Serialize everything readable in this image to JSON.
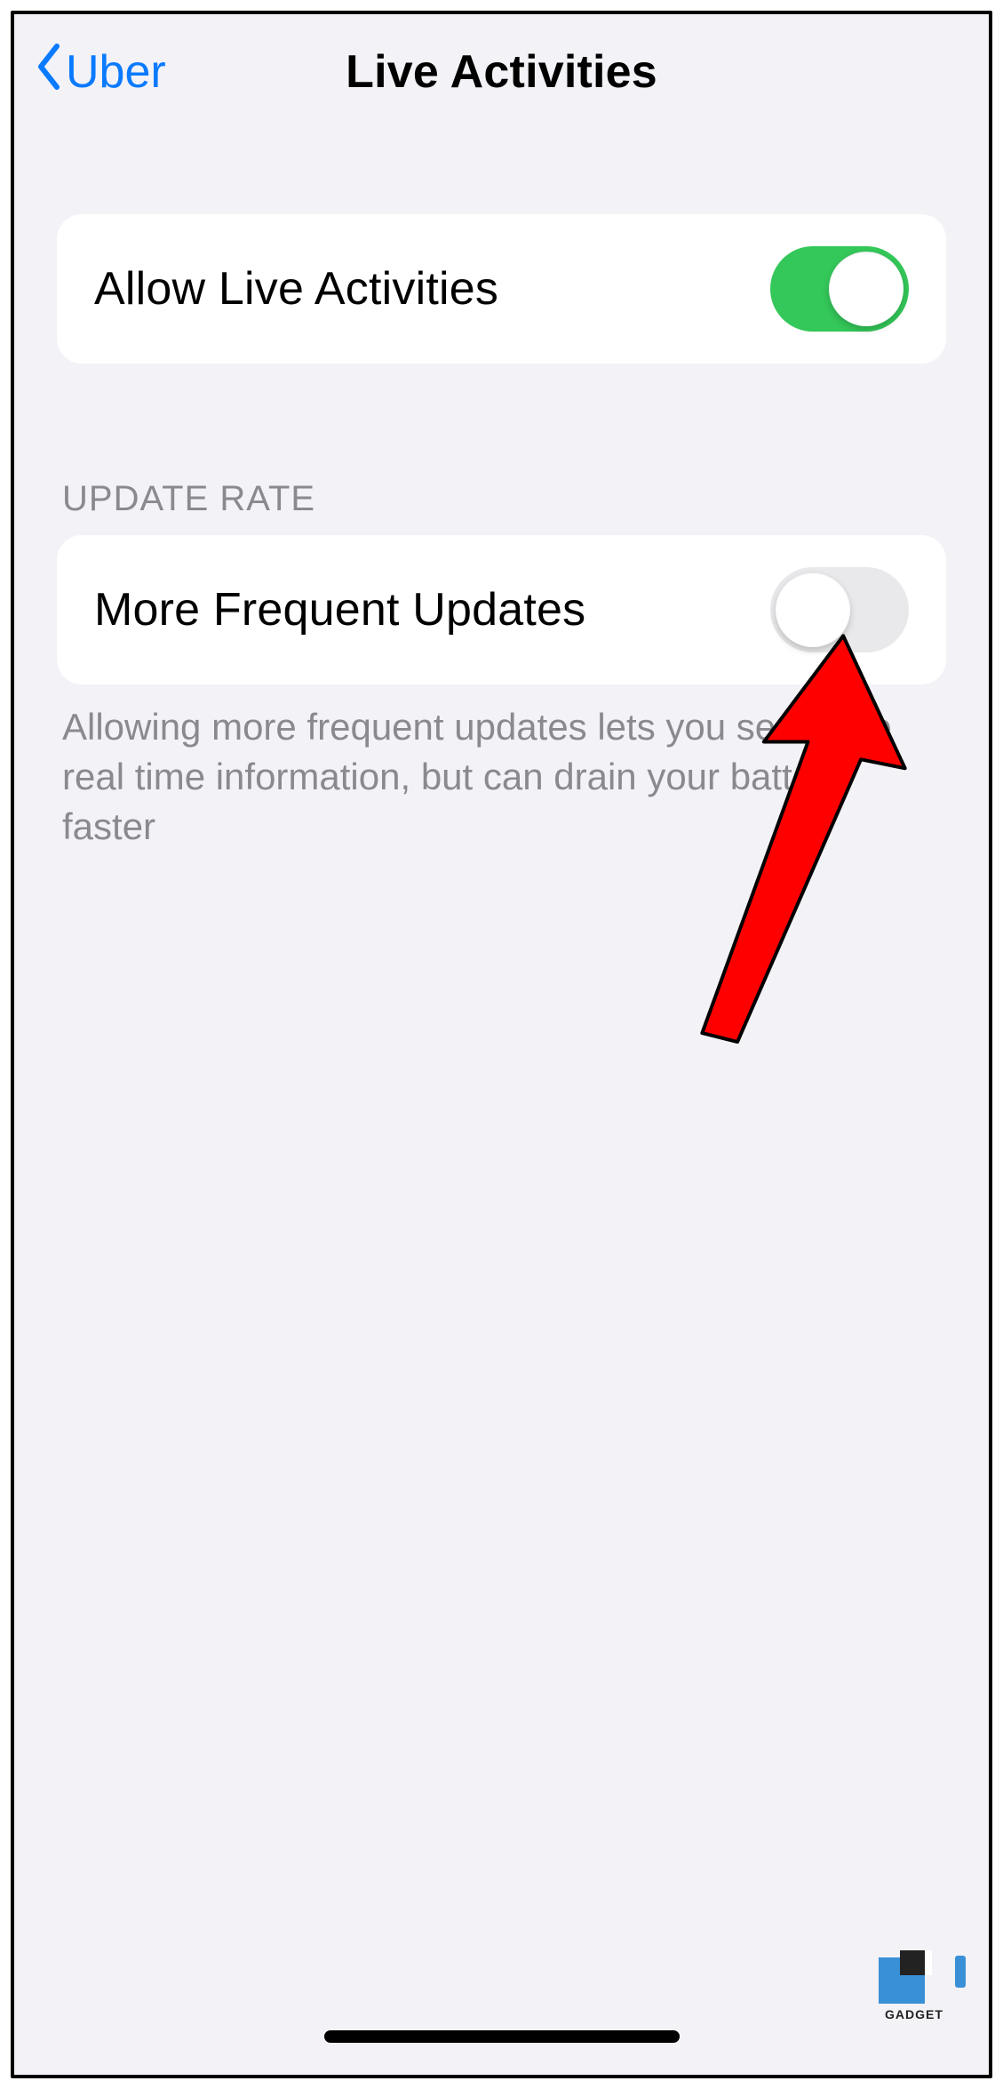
{
  "nav": {
    "back_label": "Uber",
    "title": "Live Activities"
  },
  "section1": {
    "rows": {
      "allow": {
        "label": "Allow Live Activities",
        "on": true
      }
    }
  },
  "section2": {
    "header": "UPDATE RATE",
    "rows": {
      "frequent": {
        "label": "More Frequent Updates",
        "on": false
      }
    },
    "footer": "Allowing more frequent updates lets you see more real time information, but can drain your battery faster"
  },
  "watermark": {
    "text": "GADGET"
  },
  "colors": {
    "toggle_on": "#34c759",
    "toggle_off": "#e9e9eb",
    "link": "#0a7aff",
    "arrow": "#ff0000"
  }
}
